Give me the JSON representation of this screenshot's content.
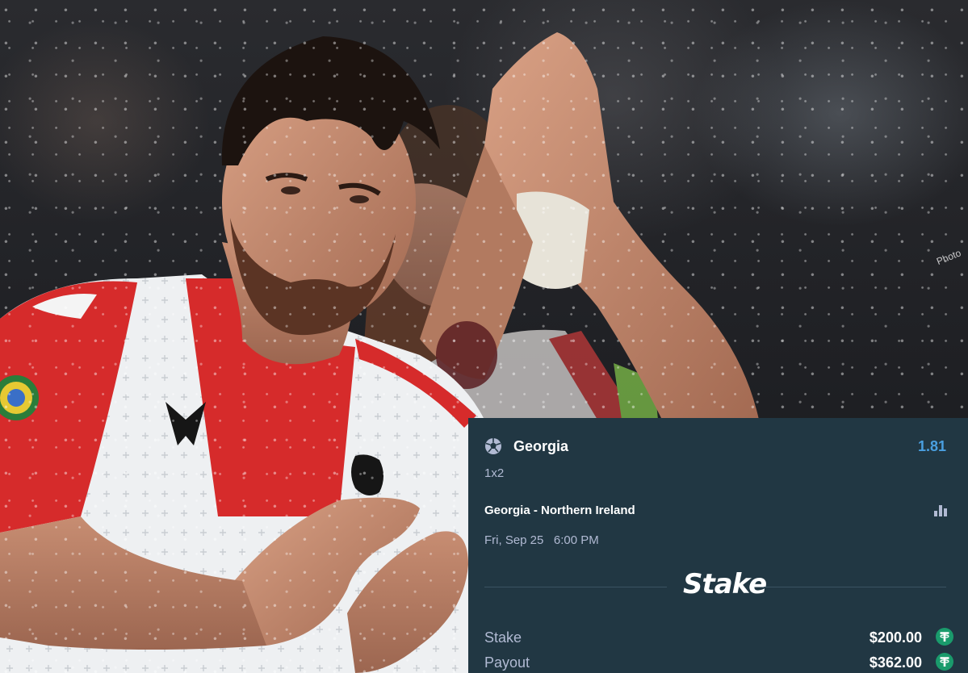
{
  "photo": {
    "watermark": "Photo"
  },
  "betslip": {
    "sport_icon": "soccer-ball-icon",
    "selection": "Georgia",
    "odds": "1.81",
    "market": "1x2",
    "match": "Georgia - Northern Ireland",
    "stats_icon": "bar-chart-icon",
    "datetime": "Fri, Sep 25   6:00 PM",
    "brand": "Stake",
    "stake_label": "Stake",
    "stake_value": "$200.00",
    "payout_label": "Payout",
    "payout_value": "$362.00",
    "currency_icon": "tether-coin-icon",
    "colors": {
      "card_bg": "#213743",
      "odds_blue": "#4a9fe0",
      "muted_text": "#b1bad3",
      "coin_green": "#1a9b6c"
    }
  }
}
